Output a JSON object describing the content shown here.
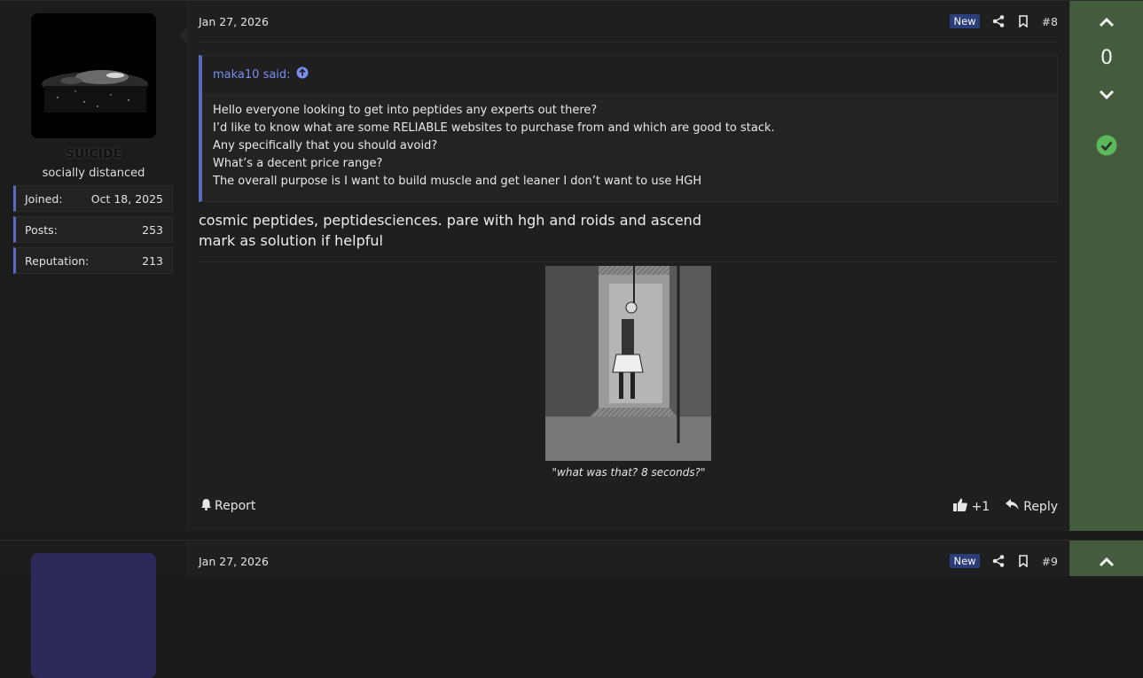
{
  "posts": [
    {
      "user": {
        "name": "SUICIDE",
        "title": "socially distanced",
        "stats": [
          {
            "label": "Joined:",
            "value": "Oct 18, 2025"
          },
          {
            "label": "Posts:",
            "value": "253"
          },
          {
            "label": "Reputation:",
            "value": "213"
          }
        ]
      },
      "date": "Jan 27, 2026",
      "badge": "New",
      "post_number": "#8",
      "quote": {
        "author": "maka10 said:",
        "lines": [
          "Hello everyone looking to get into peptides any experts out there?",
          "I’d like to know what are some RELIABLE websites to purchase from and which are good to stack.",
          "Any specifically that you should avoid?",
          "What’s a decent price range?",
          "The overall purpose is I want to build muscle and get leaner I don’t want to use HGH"
        ]
      },
      "message_lines": [
        "cosmic peptides, peptidesciences. pare with hgh and roids and ascend",
        "mark as solution if helpful"
      ],
      "signature_caption": "\"what was that? 8 seconds?\"",
      "actions": {
        "report": "Report",
        "reaction_count": "+1",
        "reply": "Reply"
      },
      "vote_score": "0"
    },
    {
      "date": "Jan 27, 2026",
      "badge": "New",
      "post_number": "#9"
    }
  ],
  "icons": {
    "share": "share-icon",
    "bookmark": "bookmark-icon",
    "upvote": "chevron-up-icon",
    "downvote": "chevron-down-icon",
    "solution": "check-circle-icon",
    "quote_jump": "arrow-up-circle-icon",
    "report": "bell-icon",
    "like": "thumbs-up-icon",
    "reply": "reply-icon"
  },
  "colors": {
    "accent": "#5c6bc0",
    "quote_link": "#7b8ef0",
    "vote_panel": "#445b3e",
    "solution_check": "#5cb85c",
    "badge_new": "#2c3e7a"
  }
}
